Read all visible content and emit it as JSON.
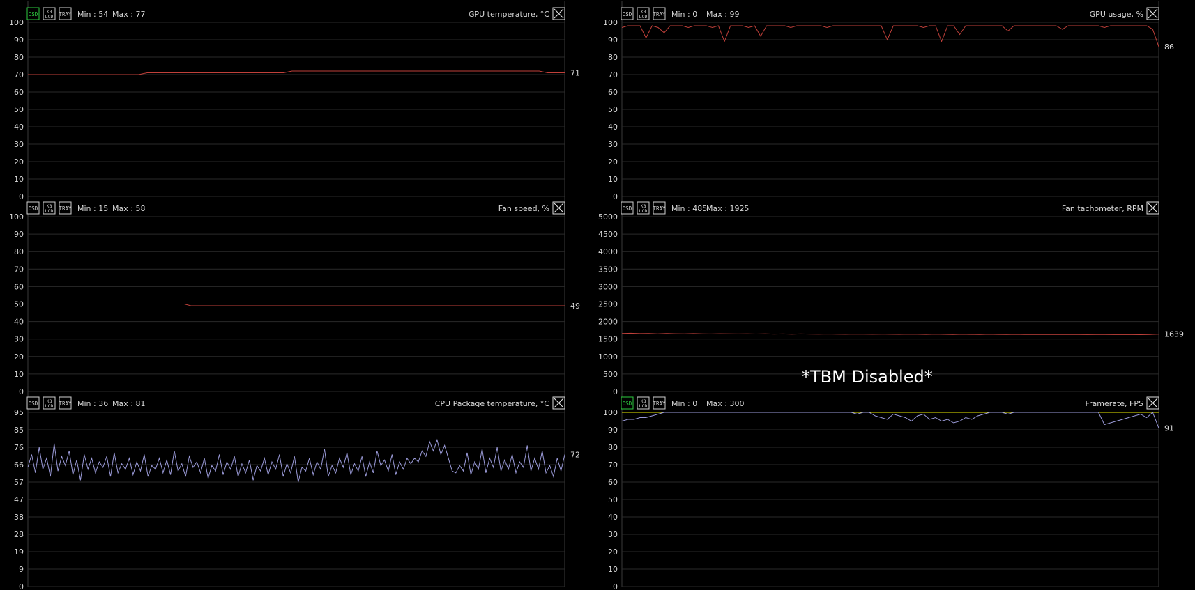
{
  "note": "*TBM Disabled*",
  "buttons": {
    "osd": "OSD",
    "lcd_top": "KB",
    "lcd_bottom": "LCD",
    "tray": "TRAY"
  },
  "colors": {
    "background": "#000000",
    "grid": "#2a2a2a",
    "axis": "#3a3a3a",
    "text": "#d8d8d8",
    "red_series": "#c0403a",
    "blue_series": "#9a9ad8",
    "yellow_series": "#e8e800",
    "osd_active": "#2ecc40"
  },
  "graphs": [
    {
      "id": "gpu-temperature",
      "title": "GPU temperature, °C",
      "min_label": "Min : 54",
      "max_label": "Max : 77",
      "current": "71",
      "osd_active": true,
      "y_ticks": [
        "100",
        "90",
        "80",
        "70",
        "60",
        "50",
        "40",
        "30",
        "20",
        "10",
        "0"
      ],
      "chart_data": {
        "type": "line",
        "ylim": [
          0,
          100
        ],
        "series": [
          {
            "color": "red",
            "values": [
              70,
              70,
              70,
              70,
              70,
              70,
              70,
              70,
              70,
              70,
              70,
              70,
              70,
              70,
              71,
              71,
              71,
              71,
              71,
              71,
              71,
              71,
              71,
              71,
              71,
              71,
              71,
              71,
              71,
              71,
              71,
              72,
              72,
              72,
              72,
              72,
              72,
              72,
              72,
              72,
              72,
              72,
              72,
              72,
              72,
              72,
              72,
              72,
              72,
              72,
              72,
              72,
              72,
              72,
              72,
              72,
              72,
              72,
              72,
              72,
              72,
              71,
              71,
              71
            ]
          }
        ]
      }
    },
    {
      "id": "gpu-usage",
      "title": "GPU usage, %",
      "min_label": "Min : 0",
      "max_label": "Max : 99",
      "current": "86",
      "osd_active": false,
      "y_ticks": [
        "100",
        "90",
        "80",
        "70",
        "60",
        "50",
        "40",
        "30",
        "20",
        "10",
        "0"
      ],
      "chart_data": {
        "type": "line",
        "ylim": [
          0,
          100
        ],
        "series": [
          {
            "color": "red",
            "values": [
              97,
              98,
              98,
              98,
              91,
              98,
              97,
              94,
              98,
              98,
              98,
              97,
              98,
              98,
              98,
              97,
              98,
              89,
              98,
              98,
              98,
              97,
              98,
              92,
              98,
              98,
              98,
              98,
              97,
              98,
              98,
              98,
              98,
              98,
              97,
              98,
              98,
              98,
              98,
              98,
              98,
              98,
              98,
              98,
              90,
              98,
              98,
              98,
              98,
              98,
              97,
              98,
              98,
              89,
              98,
              98,
              93,
              98,
              98,
              98,
              98,
              98,
              98,
              98,
              95,
              98,
              98,
              98,
              98,
              98,
              98,
              98,
              98,
              96,
              98,
              98,
              98,
              98,
              98,
              98,
              97,
              98,
              98,
              98,
              98,
              98,
              98,
              98,
              96,
              86
            ]
          }
        ]
      }
    },
    {
      "id": "fan-speed",
      "title": "Fan speed, %",
      "min_label": "Min : 15",
      "max_label": "Max : 58",
      "current": "49",
      "osd_active": false,
      "y_ticks": [
        "100",
        "90",
        "80",
        "70",
        "60",
        "50",
        "40",
        "30",
        "20",
        "10",
        "0"
      ],
      "chart_data": {
        "type": "line",
        "ylim": [
          0,
          100
        ],
        "series": [
          {
            "color": "red",
            "values": [
              50,
              50,
              50,
              50,
              50,
              50,
              50,
              50,
              50,
              50,
              50,
              50,
              50,
              50,
              50,
              50,
              50,
              50,
              50,
              50,
              50,
              50,
              50,
              50,
              49,
              49,
              49,
              49,
              49,
              49,
              49,
              49,
              49,
              49,
              49,
              49,
              49,
              49,
              49,
              49,
              49,
              49,
              49,
              49,
              49,
              49,
              49,
              49,
              49,
              49,
              49,
              49,
              49,
              49,
              49,
              49,
              49,
              49,
              49,
              49,
              49,
              49,
              49,
              49,
              49,
              49,
              49,
              49,
              49,
              49,
              49,
              49,
              49,
              49,
              49,
              49,
              49,
              49,
              49,
              49
            ]
          }
        ]
      }
    },
    {
      "id": "fan-tachometer",
      "title": "Fan tachometer, RPM",
      "min_label": "Min : 485",
      "max_label": "Max : 1925",
      "current": "1639",
      "osd_active": false,
      "y_ticks": [
        "5000",
        "4500",
        "4000",
        "3500",
        "3000",
        "2500",
        "2000",
        "1500",
        "1000",
        "500",
        "0"
      ],
      "chart_data": {
        "type": "line",
        "ylim": [
          0,
          5000
        ],
        "series": [
          {
            "color": "red",
            "values": [
              1660,
              1665,
              1655,
              1660,
              1650,
              1658,
              1652,
              1648,
              1655,
              1650,
              1645,
              1652,
              1648,
              1645,
              1650,
              1644,
              1648,
              1642,
              1646,
              1640,
              1645,
              1642,
              1638,
              1644,
              1640,
              1636,
              1642,
              1638,
              1635,
              1640,
              1636,
              1634,
              1638,
              1635,
              1632,
              1637,
              1634,
              1630,
              1636,
              1632,
              1630,
              1635,
              1631,
              1628,
              1634,
              1630,
              1628,
              1632,
              1629,
              1627,
              1632,
              1628,
              1626,
              1630,
              1627,
              1625,
              1630,
              1626,
              1624,
              1629,
              1639
            ]
          }
        ]
      }
    },
    {
      "id": "cpu-package-temperature",
      "title": "CPU Package temperature, °C",
      "min_label": "Min : 36",
      "max_label": "Max : 81",
      "current": "72",
      "osd_active": false,
      "y_ticks": [
        "95",
        "85",
        "76",
        "66",
        "57",
        "47",
        "38",
        "28",
        "19",
        "9",
        "0"
      ],
      "chart_data": {
        "type": "line",
        "ylim": [
          0,
          95
        ],
        "series": [
          {
            "color": "blue",
            "values": [
              65,
              72,
              62,
              76,
              64,
              70,
              60,
              78,
              63,
              71,
              66,
              74,
              61,
              69,
              58,
              72,
              64,
              70,
              62,
              68,
              65,
              71,
              60,
              73,
              62,
              67,
              64,
              70,
              61,
              68,
              63,
              72,
              60,
              66,
              64,
              70,
              62,
              69,
              61,
              74,
              63,
              67,
              60,
              71,
              65,
              68,
              62,
              70,
              59,
              66,
              63,
              72,
              61,
              68,
              64,
              71,
              60,
              67,
              62,
              69,
              58,
              66,
              63,
              70,
              61,
              68,
              64,
              72,
              60,
              67,
              62,
              71,
              57,
              65,
              63,
              70,
              61,
              68,
              64,
              75,
              60,
              66,
              62,
              70,
              65,
              73,
              61,
              67,
              63,
              71,
              60,
              68,
              62,
              74,
              66,
              69,
              63,
              72,
              61,
              68,
              64,
              70,
              67,
              70,
              68,
              74,
              71,
              79,
              74,
              80,
              72,
              77,
              70,
              63,
              62,
              66,
              63,
              73,
              61,
              68,
              64,
              75,
              62,
              70,
              65,
              76,
              63,
              69,
              64,
              72,
              62,
              68,
              65,
              77,
              63,
              70,
              64,
              74,
              62,
              66,
              60,
              70,
              63,
              72
            ]
          }
        ]
      }
    },
    {
      "id": "framerate",
      "title": "Framerate, FPS",
      "min_label": "Min : 0",
      "max_label": "Max : 300",
      "current": "91",
      "osd_active": true,
      "y_ticks": [
        "100",
        "90",
        "80",
        "70",
        "60",
        "50",
        "40",
        "30",
        "20",
        "10",
        "0"
      ],
      "chart_data": {
        "type": "line",
        "ylim": [
          0,
          100
        ],
        "series": [
          {
            "color": "yellow",
            "values": [
              100,
              100,
              100,
              100,
              100,
              100,
              100,
              100,
              100,
              100,
              100,
              100,
              100,
              100,
              100,
              100,
              100,
              100,
              100,
              100,
              100,
              100,
              100,
              100,
              100,
              100,
              100,
              100,
              100,
              100,
              100,
              100,
              100,
              100,
              100,
              100,
              100,
              100,
              100,
              100,
              100,
              100,
              100,
              100,
              100,
              100,
              100,
              100,
              100,
              100,
              100,
              100,
              100,
              100,
              100,
              100,
              100,
              100,
              100,
              100,
              100,
              100,
              100,
              100,
              100,
              100,
              100,
              100,
              100,
              100,
              100,
              100,
              100,
              100,
              100,
              100,
              100,
              100,
              100,
              100,
              100,
              100,
              100,
              100,
              100,
              100,
              100,
              100,
              100,
              100
            ]
          },
          {
            "color": "blue",
            "values": [
              95,
              96,
              96,
              97,
              97,
              98,
              99,
              100,
              100,
              100,
              100,
              100,
              100,
              100,
              100,
              100,
              100,
              100,
              100,
              100,
              100,
              100,
              100,
              100,
              100,
              100,
              100,
              100,
              100,
              100,
              100,
              100,
              100,
              100,
              100,
              100,
              100,
              100,
              100,
              99,
              100,
              100,
              98,
              97,
              96,
              99,
              98,
              97,
              95,
              98,
              99,
              96,
              97,
              95,
              96,
              94,
              95,
              97,
              96,
              98,
              99,
              100,
              100,
              100,
              99,
              100,
              100,
              100,
              100,
              100,
              100,
              100,
              100,
              100,
              100,
              100,
              100,
              100,
              100,
              100,
              93,
              94,
              95,
              96,
              97,
              98,
              99,
              97,
              100,
              91
            ]
          }
        ]
      }
    }
  ]
}
